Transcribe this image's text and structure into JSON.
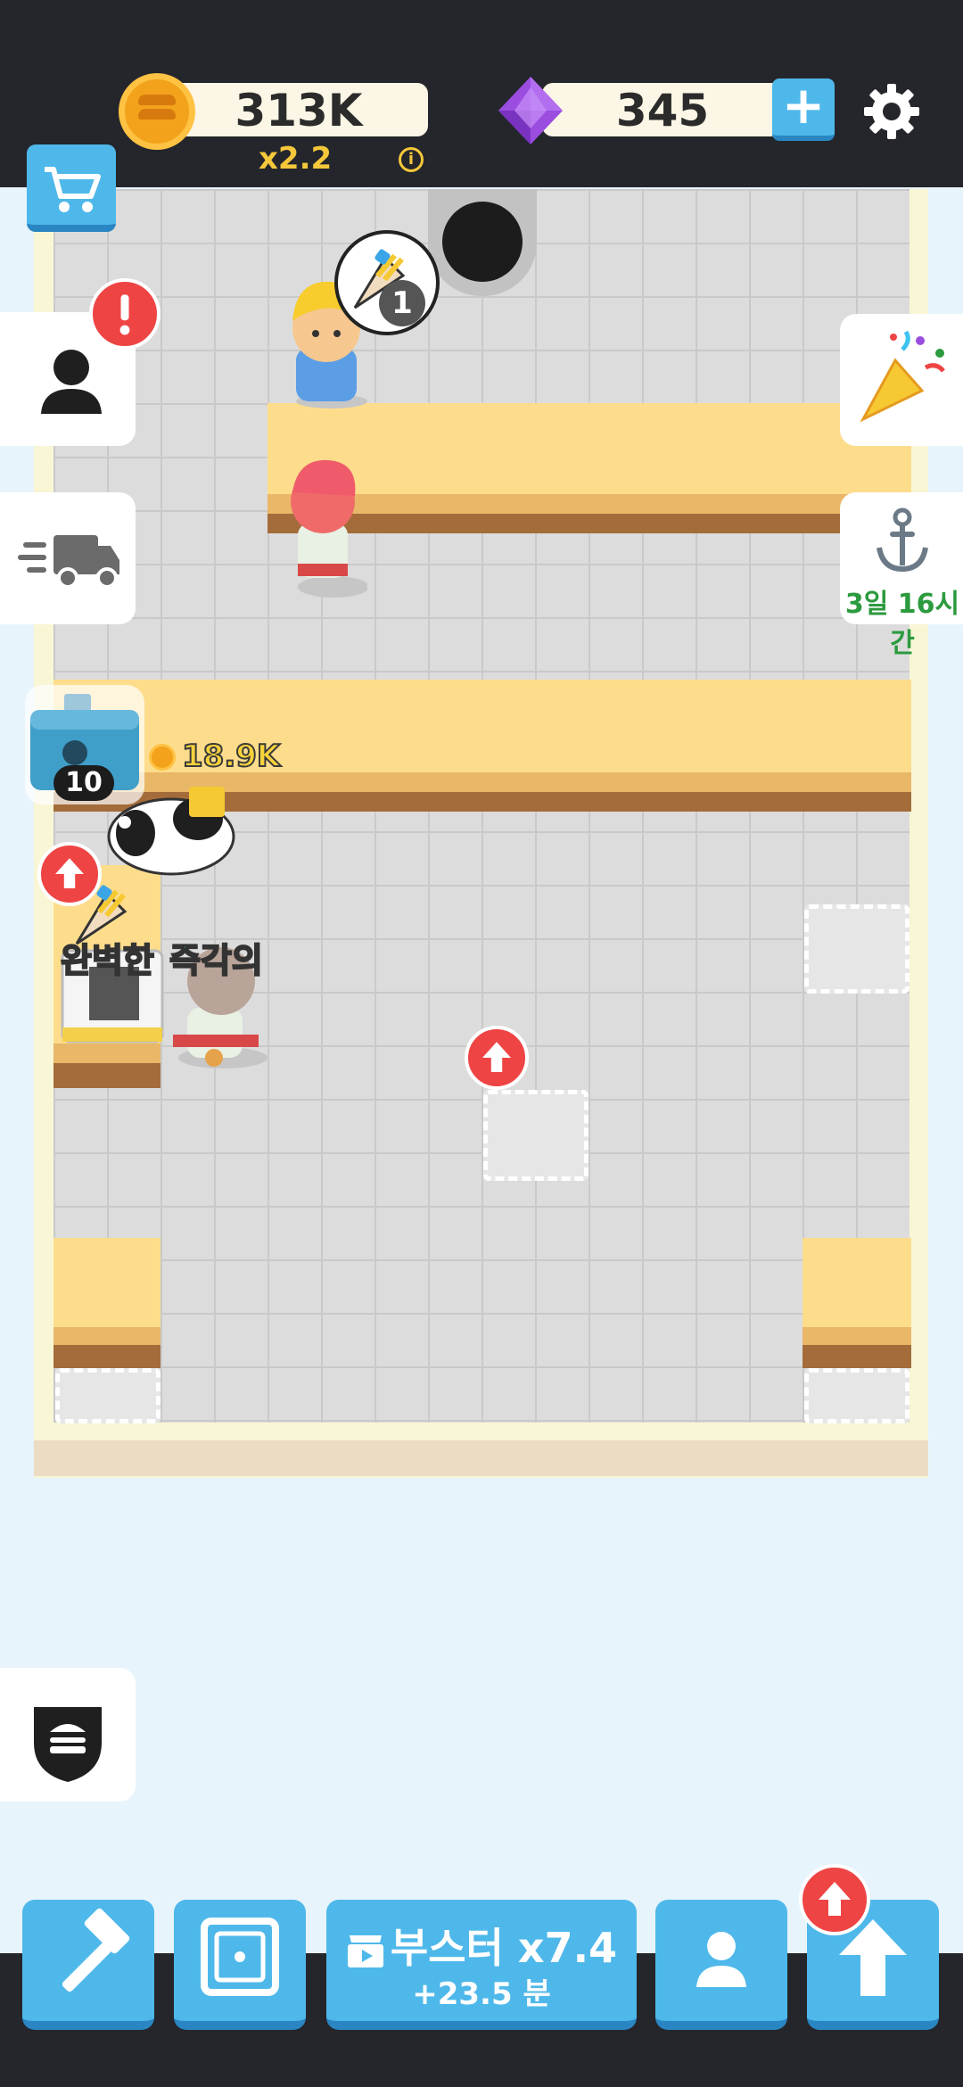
{
  "header": {
    "coins": "313K",
    "multiplier": "x2.2",
    "info_symbol": "i",
    "gems": "345",
    "plus_symbol": "+"
  },
  "game": {
    "earnings": "18.9K",
    "order_count": "1",
    "chest_count": "10",
    "perfect_word": "완벽한",
    "instant_word": "즉각의",
    "event_timer": "3일 16시간"
  },
  "bottom": {
    "booster_label": "부스터 x7.4",
    "booster_time": "+23.5 분"
  },
  "colors": {
    "accent_blue": "#4fb8ea",
    "alert_red": "#ef4444",
    "counter_top": "#fddd8c",
    "timer_green": "#2c9a3e",
    "coin_gold": "#f2a31b",
    "gem_purple": "#9b4de0"
  },
  "icons": [
    "coin-icon",
    "gem-icon",
    "plus-icon",
    "gear-icon",
    "cart-icon",
    "person-icon",
    "alert-icon",
    "truck-icon",
    "party-popper-icon",
    "anchor-icon",
    "chest-icon",
    "burger-badge-icon",
    "hammer-icon",
    "safe-icon",
    "video-icon",
    "user-icon",
    "up-arrow-icon"
  ]
}
